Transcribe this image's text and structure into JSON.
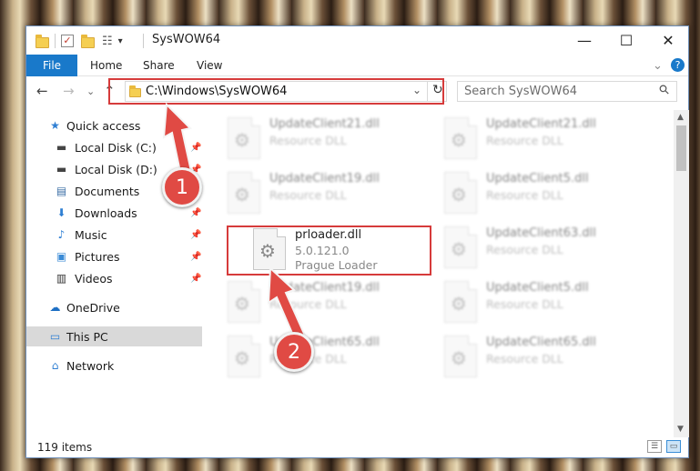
{
  "window": {
    "title": "SysWOW64",
    "minimize": "—",
    "maximize": "☐",
    "close": "✕"
  },
  "ribbon": {
    "tabs": [
      "File",
      "Home",
      "Share",
      "View"
    ],
    "help": "?",
    "expand": "⌄"
  },
  "nav": {
    "back": "←",
    "forward": "→",
    "recent": "⌄",
    "up": "↑",
    "address": "C:\\Windows\\SysWOW64",
    "address_dropdown": "⌄",
    "refresh": "↻",
    "search_placeholder": "Search SysWOW64",
    "search_icon": "⚲"
  },
  "sidebar": {
    "items": [
      {
        "label": "Quick access",
        "icon": "star-icon",
        "glyph": "★",
        "pinned": false
      },
      {
        "label": "Local Disk (C:)",
        "icon": "drive-icon",
        "glyph": "▬",
        "pinned": true
      },
      {
        "label": "Local Disk (D:)",
        "icon": "drive-icon",
        "glyph": "▬",
        "pinned": true
      },
      {
        "label": "Documents",
        "icon": "documents-icon",
        "glyph": "▤",
        "pinned": true
      },
      {
        "label": "Downloads",
        "icon": "download-icon",
        "glyph": "⬇",
        "pinned": true
      },
      {
        "label": "Music",
        "icon": "music-icon",
        "glyph": "♪",
        "pinned": true
      },
      {
        "label": "Pictures",
        "icon": "pictures-icon",
        "glyph": "▣",
        "pinned": true
      },
      {
        "label": "Videos",
        "icon": "videos-icon",
        "glyph": "▥",
        "pinned": true
      },
      {
        "label": "OneDrive",
        "icon": "cloud-icon",
        "glyph": "☁",
        "pinned": false
      },
      {
        "label": "This PC",
        "icon": "computer-icon",
        "glyph": "▭",
        "pinned": false,
        "selected": true
      },
      {
        "label": "Network",
        "icon": "network-icon",
        "glyph": "⌂",
        "pinned": false
      }
    ],
    "pin_glyph": "📌"
  },
  "files": [
    {
      "name": "UpdateClient21.dll",
      "type": "Resource DLL"
    },
    {
      "name": "UpdateClient21.dll",
      "type": "Resource DLL"
    },
    {
      "name": "UpdateClient19.dll",
      "type": "Resource DLL"
    },
    {
      "name": "UpdateClient5.dll",
      "type": "Resource DLL"
    },
    {
      "name": "prloader.dll",
      "version": "5.0.121.0",
      "type": "Prague Loader"
    },
    {
      "name": "UpdateClient63.dll",
      "type": "Resource DLL"
    },
    {
      "name": "UpdateClient19.dll",
      "type": "Resource DLL"
    },
    {
      "name": "UpdateClient5.dll",
      "type": "Resource DLL"
    },
    {
      "name": "UpdateClient65.dll",
      "type": "Resource DLL"
    },
    {
      "name": "UpdateClient65.dll",
      "type": "Resource DLL"
    }
  ],
  "status": {
    "item_count": "119 items"
  },
  "annotations": {
    "step1": "1",
    "step2": "2",
    "highlight_color": "#d63b3b"
  },
  "colors": {
    "accent": "#1979ca",
    "selection": "#d9d9d9"
  }
}
